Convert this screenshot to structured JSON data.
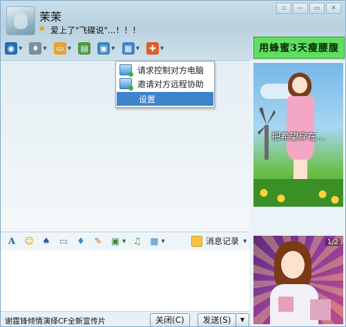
{
  "header": {
    "nickname": "茉茉",
    "signature": "爱上了\"飞碟说\"...！！！"
  },
  "window_controls": {
    "menu_label": "▫",
    "minimize_label": "—",
    "maximize_label": "▭",
    "close_label": "✕"
  },
  "toolbar": {
    "items": [
      {
        "name": "video-icon",
        "glyph": "◉",
        "color": "#1f6fb0"
      },
      {
        "name": "mic-icon",
        "glyph": "♦",
        "color": "#7d8f9c"
      },
      {
        "name": "file-transfer-icon",
        "glyph": "▭",
        "color": "#e7a334"
      },
      {
        "name": "app-icon",
        "glyph": "▤",
        "color": "#4a9a46"
      },
      {
        "name": "remote-assist-icon",
        "glyph": "▣",
        "color": "#3a86c8"
      },
      {
        "name": "screen-share-icon",
        "glyph": "▦",
        "color": "#3a86c8"
      },
      {
        "name": "apps-grid-icon",
        "glyph": "✚",
        "color": "#e05d2a"
      }
    ]
  },
  "ad_banner": {
    "text": "用蜂蜜3天瘦腰腹"
  },
  "ad_top": {
    "caption": "把希望穿在..."
  },
  "context_menu": {
    "items": [
      {
        "label": "请求控制对方电脑"
      },
      {
        "label": "邀请对方远程协助"
      },
      {
        "label": "设置"
      }
    ]
  },
  "input_toolbar": {
    "history_label": "消息记录"
  },
  "input_area": {
    "value": ""
  },
  "bottom_bar": {
    "status_text": "谢霆锋倾情演绎CF全新宣传片",
    "close_label": "关闭(C)",
    "send_label": "发送(S)"
  },
  "ad_bottom": {
    "page_indicator": "1/2"
  }
}
